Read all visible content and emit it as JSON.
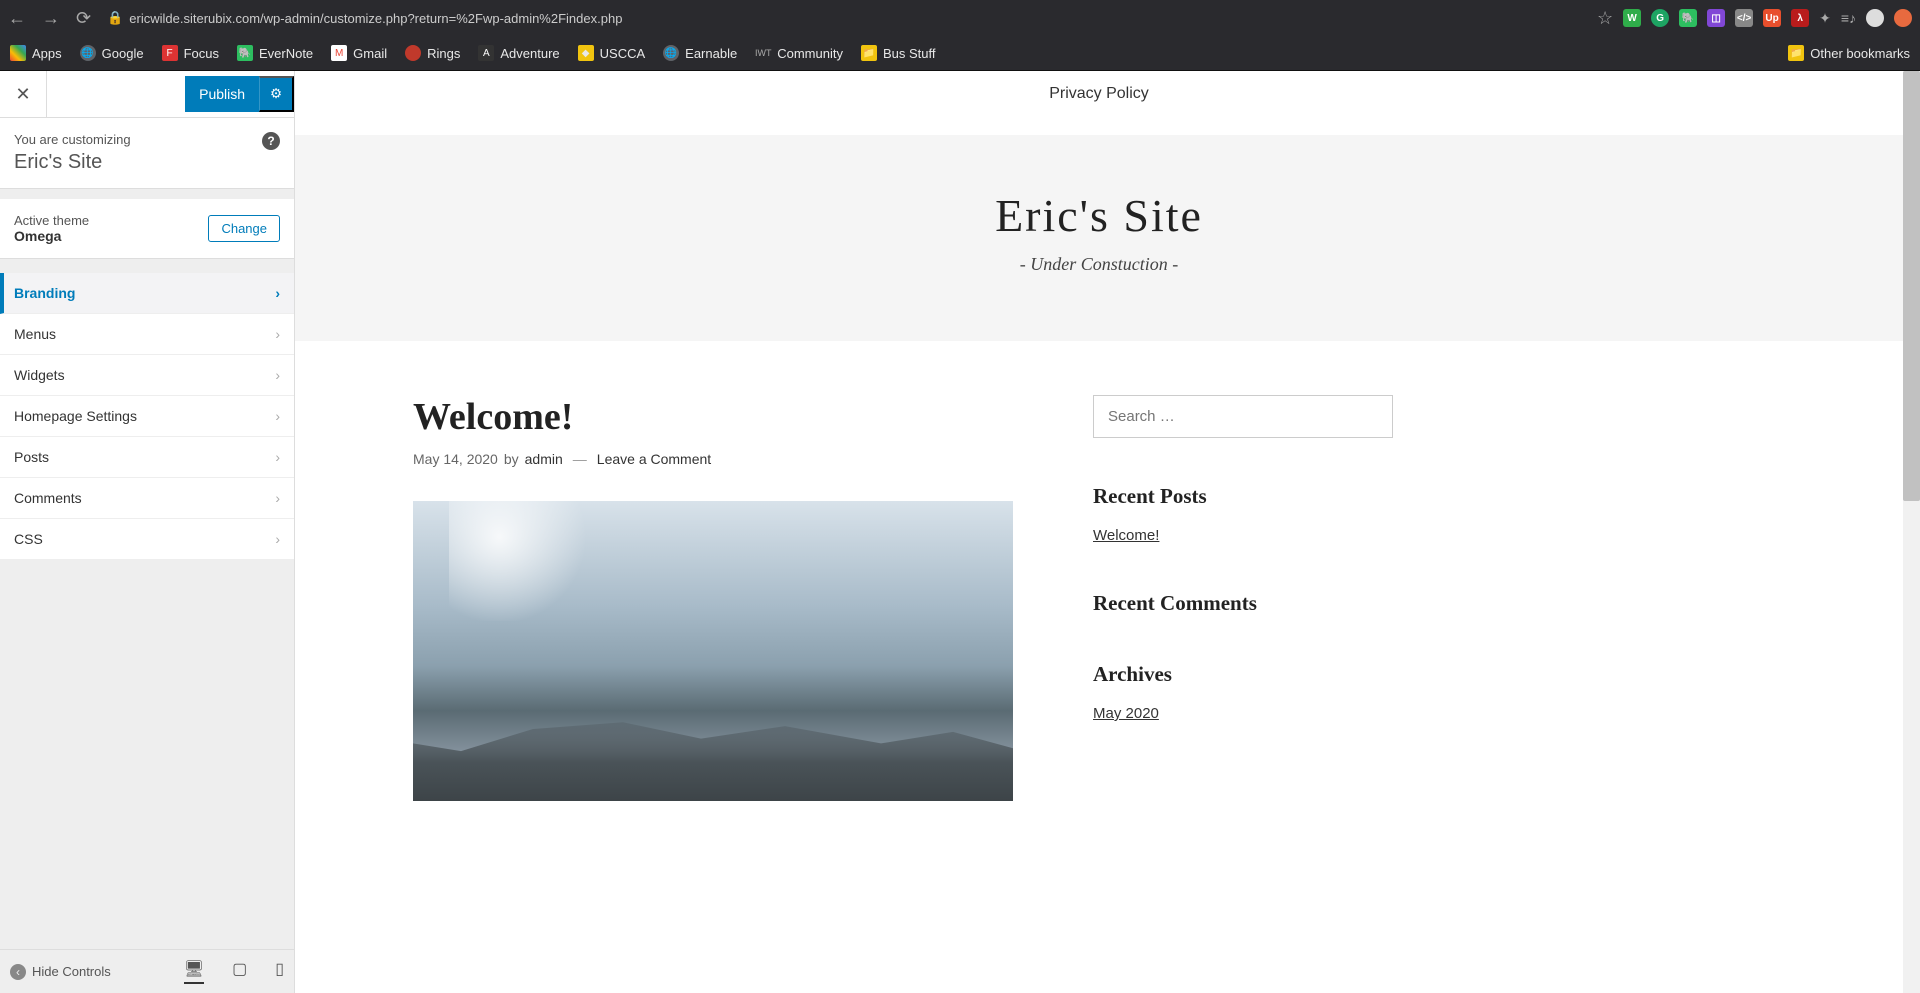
{
  "browser": {
    "url": "ericwilde.siterubix.com/wp-admin/customize.php?return=%2Fwp-admin%2Findex.php",
    "bookmarks": [
      "Apps",
      "Google",
      "Focus",
      "EverNote",
      "Gmail",
      "Rings",
      "Adventure",
      "USCCA",
      "Earnable",
      "Community",
      "Bus Stuff"
    ],
    "other_bookmarks": "Other bookmarks"
  },
  "customizer": {
    "publish_label": "Publish",
    "customizing_label": "You are customizing",
    "site_name": "Eric's Site",
    "active_theme_label": "Active theme",
    "theme_name": "Omega",
    "change_label": "Change",
    "menu": [
      "Branding",
      "Menus",
      "Widgets",
      "Homepage Settings",
      "Posts",
      "Comments",
      "CSS"
    ],
    "hide_controls": "Hide Controls"
  },
  "preview": {
    "nav_link": "Privacy Policy",
    "site_title": "Eric's Site",
    "tagline": "- Under Constuction -",
    "post": {
      "title": "Welcome!",
      "date": "May 14, 2020",
      "by": "by",
      "author": "admin",
      "comment_link": "Leave a Comment"
    },
    "sidebar": {
      "search_placeholder": "Search …",
      "recent_posts_title": "Recent Posts",
      "recent_posts": [
        "Welcome!"
      ],
      "recent_comments_title": "Recent Comments",
      "archives_title": "Archives",
      "archives": [
        "May 2020"
      ]
    }
  }
}
